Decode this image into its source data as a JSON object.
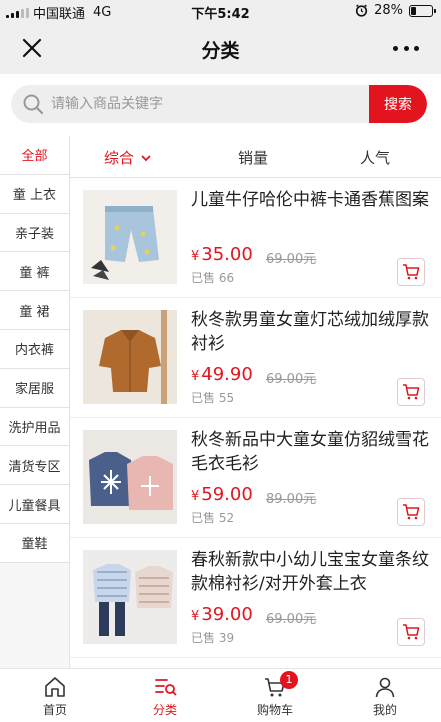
{
  "status_bar": {
    "carrier": "中国联通",
    "network": "4G",
    "time": "下午5:42",
    "battery_percent": "28%",
    "battery_level": 0.28
  },
  "header": {
    "title": "分类",
    "close_icon": "close-icon",
    "more_icon": "more-icon"
  },
  "search": {
    "placeholder": "请输入商品关键字",
    "button_label": "搜索"
  },
  "sidebar": {
    "items": [
      {
        "label": "全部",
        "active": true
      },
      {
        "label": "童 上衣"
      },
      {
        "label": "亲子装"
      },
      {
        "label": "童 裤"
      },
      {
        "label": "童 裙"
      },
      {
        "label": "内衣裤"
      },
      {
        "label": "家居服"
      },
      {
        "label": "洗护用品"
      },
      {
        "label": "清货专区"
      },
      {
        "label": "儿童餐具"
      },
      {
        "label": "童鞋"
      }
    ]
  },
  "sort": {
    "items": [
      {
        "label": "综合",
        "active": true
      },
      {
        "label": "销量"
      },
      {
        "label": "人气"
      }
    ]
  },
  "products": [
    {
      "title": "儿童牛仔哈伦中裤卡通香蕉图案",
      "currency": "¥",
      "price": "35.00",
      "orig_price": "69.00元",
      "sold": "已售 66"
    },
    {
      "title": "秋冬款男童女童灯芯绒加绒厚款衬衫",
      "currency": "¥",
      "price": "49.90",
      "orig_price": "69.00元",
      "sold": "已售 55"
    },
    {
      "title": "秋冬新品中大童女童仿貂绒雪花毛衣毛衫",
      "currency": "¥",
      "price": "59.00",
      "orig_price": "89.00元",
      "sold": "已售 52"
    },
    {
      "title": "春秋新款中小幼儿宝宝女童条纹款棉衬衫/对开外套上衣",
      "currency": "¥",
      "price": "39.00",
      "orig_price": "69.00元",
      "sold": "已售 39"
    }
  ],
  "tabbar": {
    "items": [
      {
        "label": "首页",
        "icon": "home-icon"
      },
      {
        "label": "分类",
        "icon": "category-icon",
        "active": true
      },
      {
        "label": "购物车",
        "icon": "cart-icon",
        "badge": "1"
      },
      {
        "label": "我的",
        "icon": "user-icon"
      }
    ]
  },
  "colors": {
    "accent": "#e2151f",
    "text": "#333333",
    "muted": "#999999"
  }
}
